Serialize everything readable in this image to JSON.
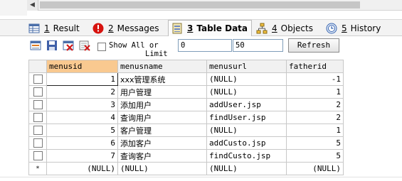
{
  "tabs": [
    {
      "num": "1",
      "label": "Result",
      "icon": "result-grid-icon"
    },
    {
      "num": "2",
      "label": "Messages",
      "icon": "info-red-icon"
    },
    {
      "num": "3",
      "label": "Table Data",
      "icon": "table-data-icon"
    },
    {
      "num": "4",
      "label": "Objects",
      "icon": "objects-tree-icon"
    },
    {
      "num": "5",
      "label": "History",
      "icon": "history-icon"
    }
  ],
  "toolbar": {
    "show_all": "Show All or",
    "limit": "Limit",
    "offset_value": "0",
    "limit_value": "50",
    "refresh": "Refresh"
  },
  "grid": {
    "columns": [
      "menusid",
      "menusname",
      "menusurl",
      "fatherid"
    ],
    "rows": [
      {
        "menusid": "1",
        "menusname": "xxx管理系统",
        "menusurl": "(NULL)",
        "fatherid": "-1"
      },
      {
        "menusid": "2",
        "menusname": "用户管理",
        "menusurl": "(NULL)",
        "fatherid": "1"
      },
      {
        "menusid": "3",
        "menusname": "添加用户",
        "menusurl": "addUser.jsp",
        "fatherid": "2"
      },
      {
        "menusid": "4",
        "menusname": "查询用户",
        "menusurl": "findUser.jsp",
        "fatherid": "2"
      },
      {
        "menusid": "5",
        "menusname": "客户管理",
        "menusurl": "(NULL)",
        "fatherid": "1"
      },
      {
        "menusid": "6",
        "menusname": "添加客户",
        "menusurl": "addCusto.jsp",
        "fatherid": "5"
      },
      {
        "menusid": "7",
        "menusname": "查询客户",
        "menusurl": "findCusto.jsp",
        "fatherid": "5"
      }
    ],
    "new_row": {
      "marker": "*",
      "menusid": "(NULL)",
      "menusname": "(NULL)",
      "menusurl": "(NULL)",
      "fatherid": "(NULL)"
    }
  },
  "colors": {
    "selected_header": "#f9c990",
    "grid_border": "#c8c8c8"
  }
}
